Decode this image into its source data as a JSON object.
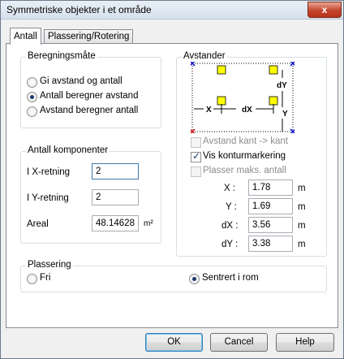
{
  "window": {
    "title": "Symmetriske objekter i et område",
    "close_glyph": "x"
  },
  "tabs": [
    {
      "label": "Antall"
    },
    {
      "label": "Plassering/Rotering"
    }
  ],
  "beregning": {
    "legend": "Beregningsmåte",
    "options": [
      {
        "label": "Gi avstand og antall",
        "selected": false
      },
      {
        "label": "Antall beregner avstand",
        "selected": true
      },
      {
        "label": "Avstand beregner antall",
        "selected": false
      }
    ]
  },
  "antall": {
    "legend": "Antall komponenter",
    "x_label": "I X-retning",
    "x_value": "2",
    "y_label": "I Y-retning",
    "y_value": "2",
    "areal_label": "Areal",
    "areal_value": "48.14628",
    "areal_unit": "m²"
  },
  "avstander": {
    "legend": "Avstander",
    "diagram": {
      "labels": [
        "dY",
        "X",
        "dX",
        "Y"
      ]
    },
    "checks": [
      {
        "label": "Avstand kant -> kant",
        "checked": false,
        "enabled": false
      },
      {
        "label": "Vis konturmarkering",
        "checked": true,
        "enabled": true
      },
      {
        "label": "Plasser maks. antall",
        "checked": false,
        "enabled": false
      }
    ],
    "fields": [
      {
        "label": "X :",
        "value": "1.78",
        "unit": "m"
      },
      {
        "label": "Y :",
        "value": "1.69",
        "unit": "m"
      },
      {
        "label": "dX :",
        "value": "3.56",
        "unit": "m"
      },
      {
        "label": "dY :",
        "value": "3.38",
        "unit": "m"
      }
    ]
  },
  "plassering": {
    "legend": "Plassering",
    "options": [
      {
        "label": "Fri",
        "selected": false
      },
      {
        "label": "Sentrert i rom",
        "selected": true
      }
    ]
  },
  "buttons": {
    "ok": "OK",
    "cancel": "Cancel",
    "help": "Help"
  },
  "colors": {
    "square_fill": "#ffff00",
    "corner_blue": "#0000cc",
    "corner_red": "#cc0000"
  }
}
